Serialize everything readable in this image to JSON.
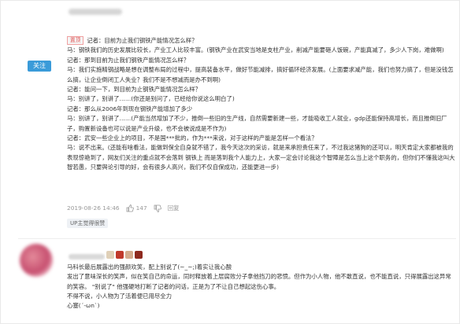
{
  "post": {
    "follow_label": "关注",
    "tag": "置顶",
    "lines": [
      "记者：目前为止我们钢铁产能情况怎么样？",
      "马：钢铁我们的历史发展比较长，产业工人比较丰富。(钢铁产业在武安当地是支柱产业，削减产能要砸人饭碗，产能真减了，多少人下岗，难做啊)",
      "记者：那到目前为止我们钢铁产能情况怎么样？",
      "马：我们实施精钢战略是想在调整布局的过程中，提高装备水平，做好节能减排，搞好循环经济发展。(上面要求减产能，我们也努力搞了，但是没钱怎么搞，让企业倒闭工人失业？我们不是不想减而是办不到啊)",
      "记者：能问一下，到目前为止钢铁产能情况怎么样？",
      "马：别讲了，别讲了……(你还是别问了，已经给你说这么明白了)",
      "记者：那么从2006年到现在钢铁产能增加了多少",
      "马：别讲了，别讲了……(产能当然增加了不少，推倒一些旧的生产线，自然需要新建一些，才能吸收工人就业，gdp还能保持高增长，而且推倒旧厂子，购置新设备也可以说是产业升级，也不会被说成是不作为)",
      "记者：武安一些企业上的项目，不是国***批的，作为***来说，对于这样的产能是怎样一个看法？",
      "马：说不出来。(还能有啥看法，能做到保全自身就不错了，我今天这次的采访，就是来承担责任来了，不过我这猪狗的还可以，明天肯定大家都被我的表现惊艳到了，网友们关注的重点就不会落到 钢铁上 而是落到我个人能力上，大家一定会讨论我这个智障是怎么当上这个职务的，但你们不懂我这叫大智若愚，只要舆论引导的好，会有很多人高兴，我们不仅自保成功，还能更进一步)"
    ],
    "timestamp": "2019-08-26 14:46",
    "likes": "147",
    "reply_label": "回复",
    "badge": "UP主觉得很赞"
  },
  "reply": {
    "lines": [
      "马科长最后展露出的强颜欢笑，配上别说了(~_~;)着实让我心酸",
      "发出了意味深长的笑声，似在笑自己的命运，同时释放着上层腐败分子拿他挡刀的悲愤。但作为小人物，他不敢直说，也不能直说，只得展露出这异常的笑容。 \"别说了\" 他强硬地打断了记者的问话，正是为了不让自己想起这伤心事。",
      "不得不说，小人物为了活着便已用尽全力",
      "心塞(´-ωn`)"
    ]
  },
  "colors": {
    "follow": "#3a9bd9",
    "tag_border": "#f0a0a0",
    "tag_text": "#e05050",
    "meta_text": "#999999"
  },
  "icons": [
    "thumbs-up-icon",
    "thumbs-down-icon",
    "reply-icon"
  ]
}
